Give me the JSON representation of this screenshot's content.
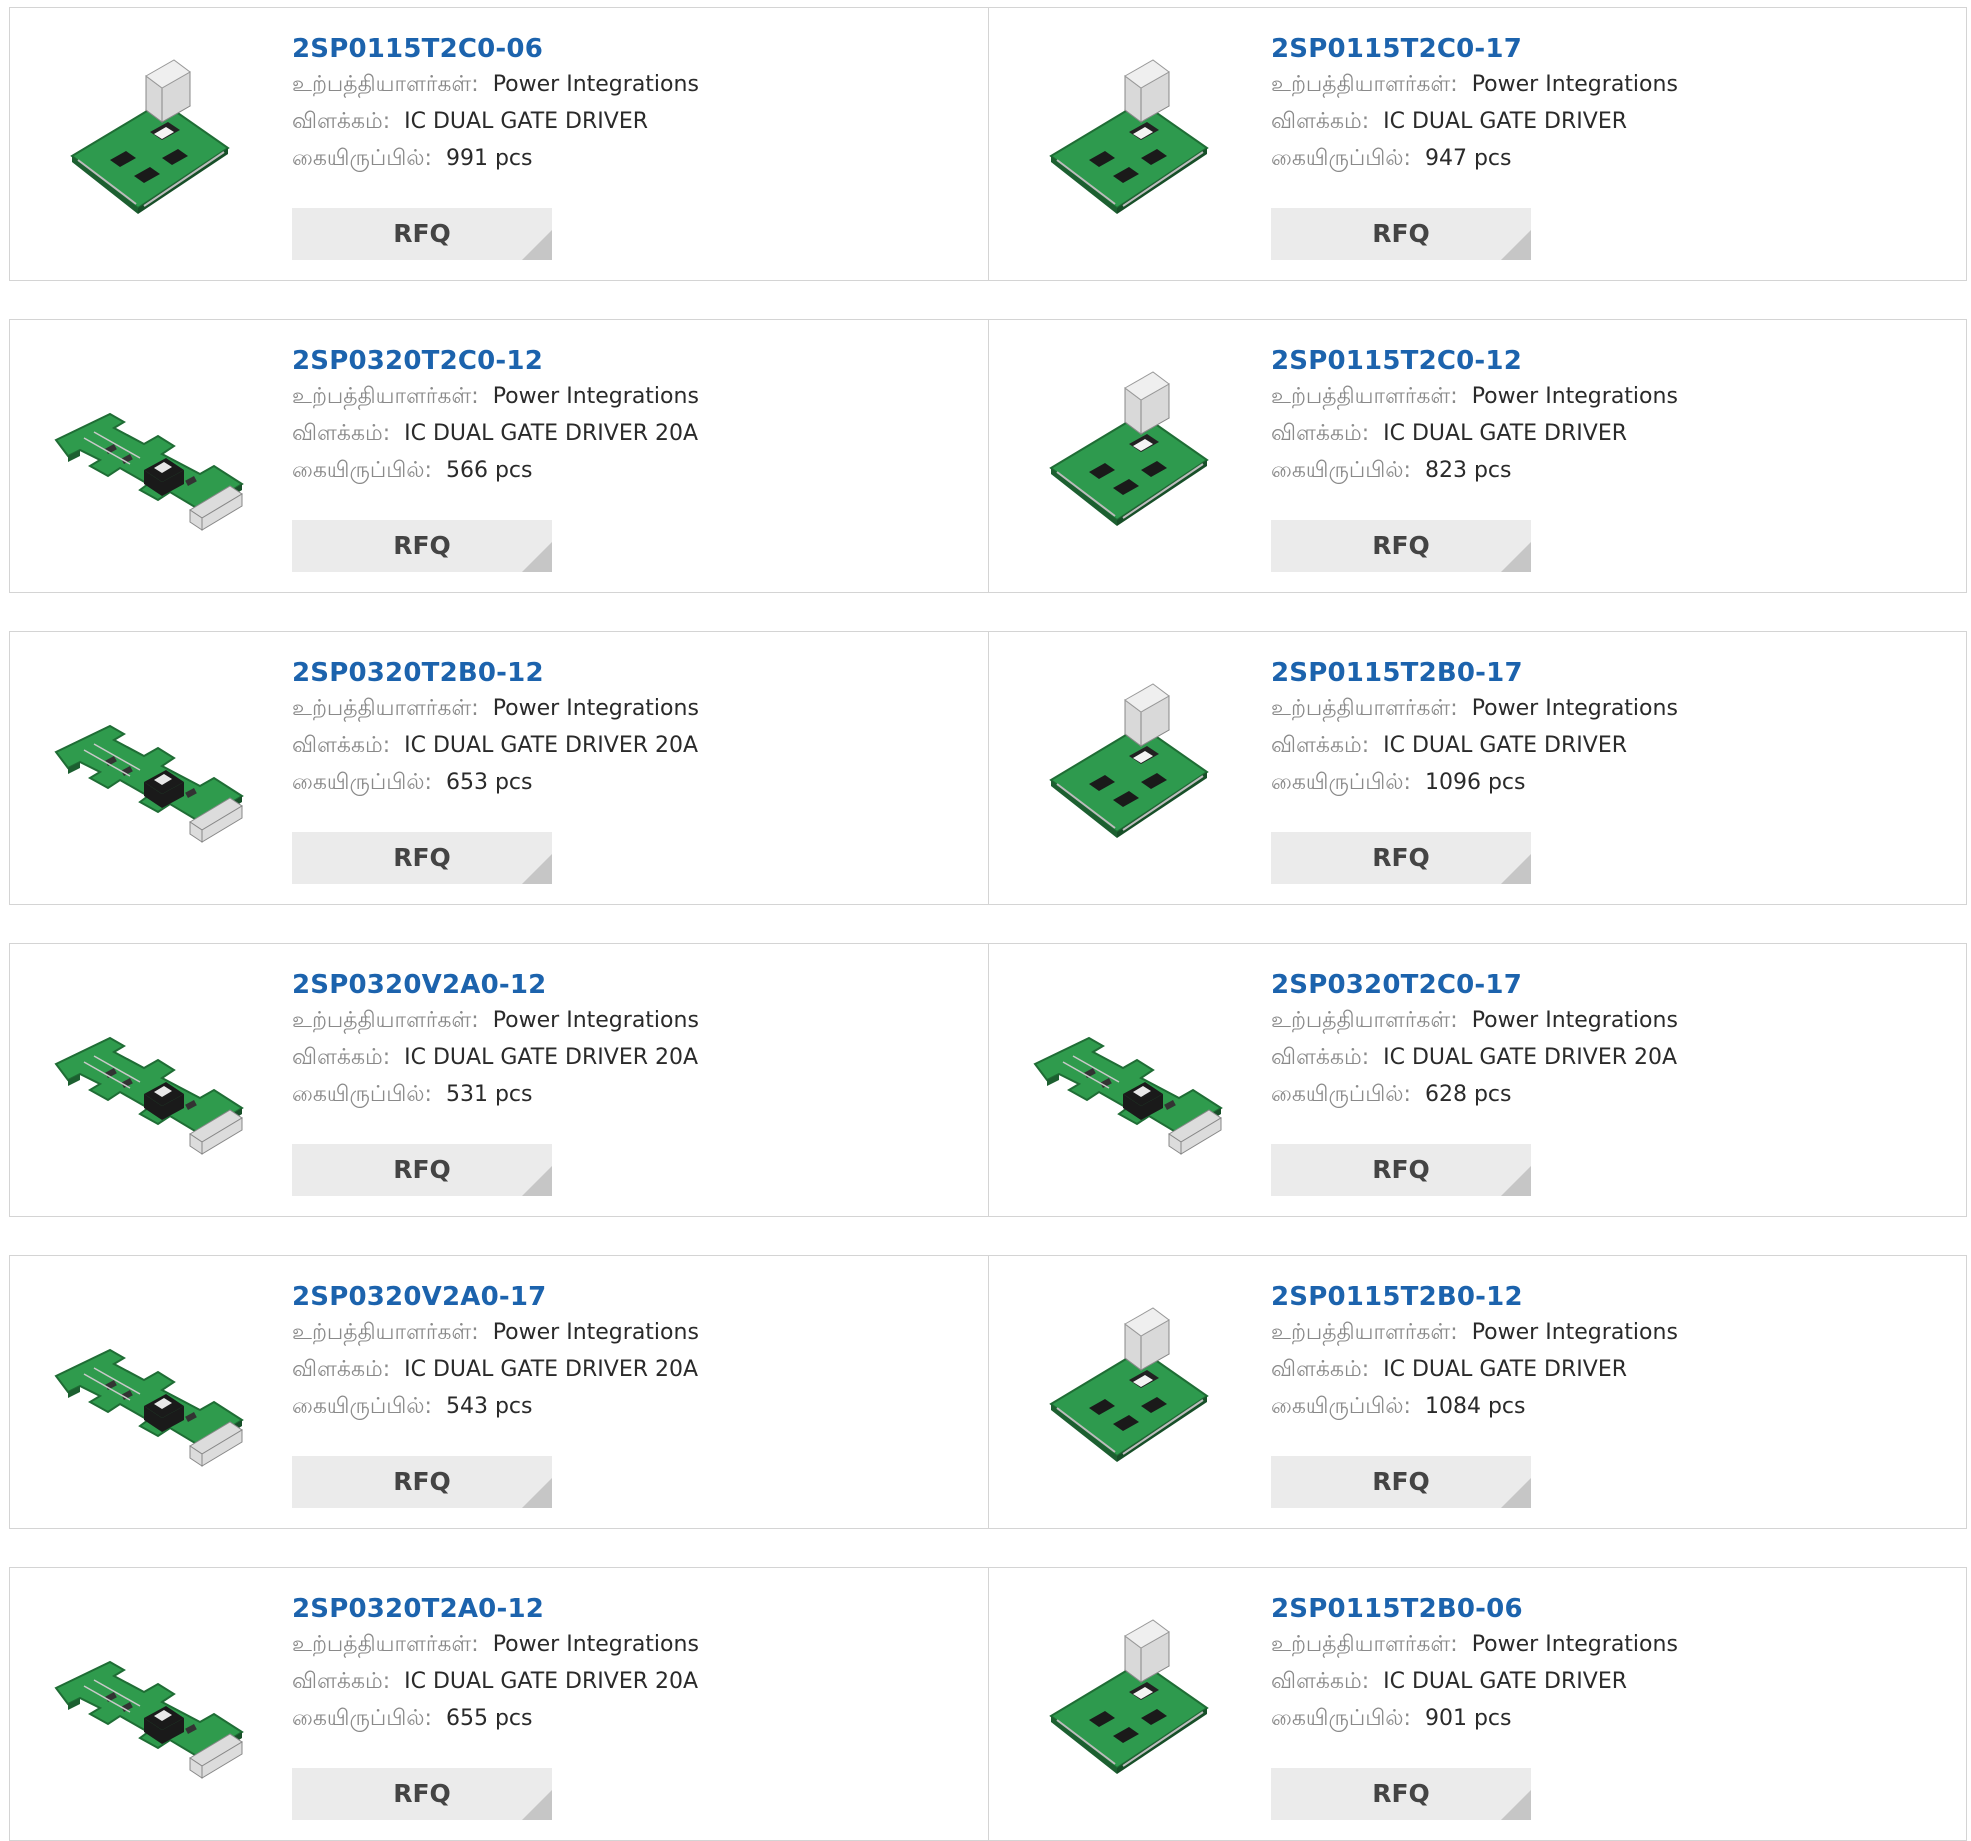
{
  "labels": {
    "manufacturer": "உற்பத்தியாளர்கள்:",
    "description": "விளக்கம்:",
    "stock": "கையிருப்பில்:",
    "rfq": "RFQ"
  },
  "colors": {
    "part_link": "#1c63ad",
    "button_bg": "#ebebeb",
    "border": "#d4d4d4"
  },
  "products": [
    {
      "part": "2SP0115T2C0-06",
      "manufacturer": "Power Integrations",
      "description": "IC DUAL GATE DRIVER",
      "stock": "991 pcs",
      "image_icon": "gate-driver-board-compact-icon"
    },
    {
      "part": "2SP0115T2C0-17",
      "manufacturer": "Power Integrations",
      "description": "IC DUAL GATE DRIVER",
      "stock": "947 pcs",
      "image_icon": "gate-driver-board-compact-icon"
    },
    {
      "part": "2SP0320T2C0-12",
      "manufacturer": "Power Integrations",
      "description": "IC DUAL GATE DRIVER 20A",
      "stock": "566 pcs",
      "image_icon": "gate-driver-board-wide-icon"
    },
    {
      "part": "2SP0115T2C0-12",
      "manufacturer": "Power Integrations",
      "description": "IC DUAL GATE DRIVER",
      "stock": "823 pcs",
      "image_icon": "gate-driver-board-compact-icon"
    },
    {
      "part": "2SP0320T2B0-12",
      "manufacturer": "Power Integrations",
      "description": "IC DUAL GATE DRIVER 20A",
      "stock": "653 pcs",
      "image_icon": "gate-driver-board-wide-icon"
    },
    {
      "part": "2SP0115T2B0-17",
      "manufacturer": "Power Integrations",
      "description": "IC DUAL GATE DRIVER",
      "stock": "1096 pcs",
      "image_icon": "gate-driver-board-compact-icon"
    },
    {
      "part": "2SP0320V2A0-12",
      "manufacturer": "Power Integrations",
      "description": "IC DUAL GATE DRIVER 20A",
      "stock": "531 pcs",
      "image_icon": "gate-driver-board-wide-icon"
    },
    {
      "part": "2SP0320T2C0-17",
      "manufacturer": "Power Integrations",
      "description": "IC DUAL GATE DRIVER 20A",
      "stock": "628 pcs",
      "image_icon": "gate-driver-board-wide-icon"
    },
    {
      "part": "2SP0320V2A0-17",
      "manufacturer": "Power Integrations",
      "description": "IC DUAL GATE DRIVER 20A",
      "stock": "543 pcs",
      "image_icon": "gate-driver-board-wide-icon"
    },
    {
      "part": "2SP0115T2B0-12",
      "manufacturer": "Power Integrations",
      "description": "IC DUAL GATE DRIVER",
      "stock": "1084 pcs",
      "image_icon": "gate-driver-board-compact-icon"
    },
    {
      "part": "2SP0320T2A0-12",
      "manufacturer": "Power Integrations",
      "description": "IC DUAL GATE DRIVER 20A",
      "stock": "655 pcs",
      "image_icon": "gate-driver-board-wide-icon"
    },
    {
      "part": "2SP0115T2B0-06",
      "manufacturer": "Power Integrations",
      "description": "IC DUAL GATE DRIVER",
      "stock": "901 pcs",
      "image_icon": "gate-driver-board-compact-icon"
    }
  ]
}
